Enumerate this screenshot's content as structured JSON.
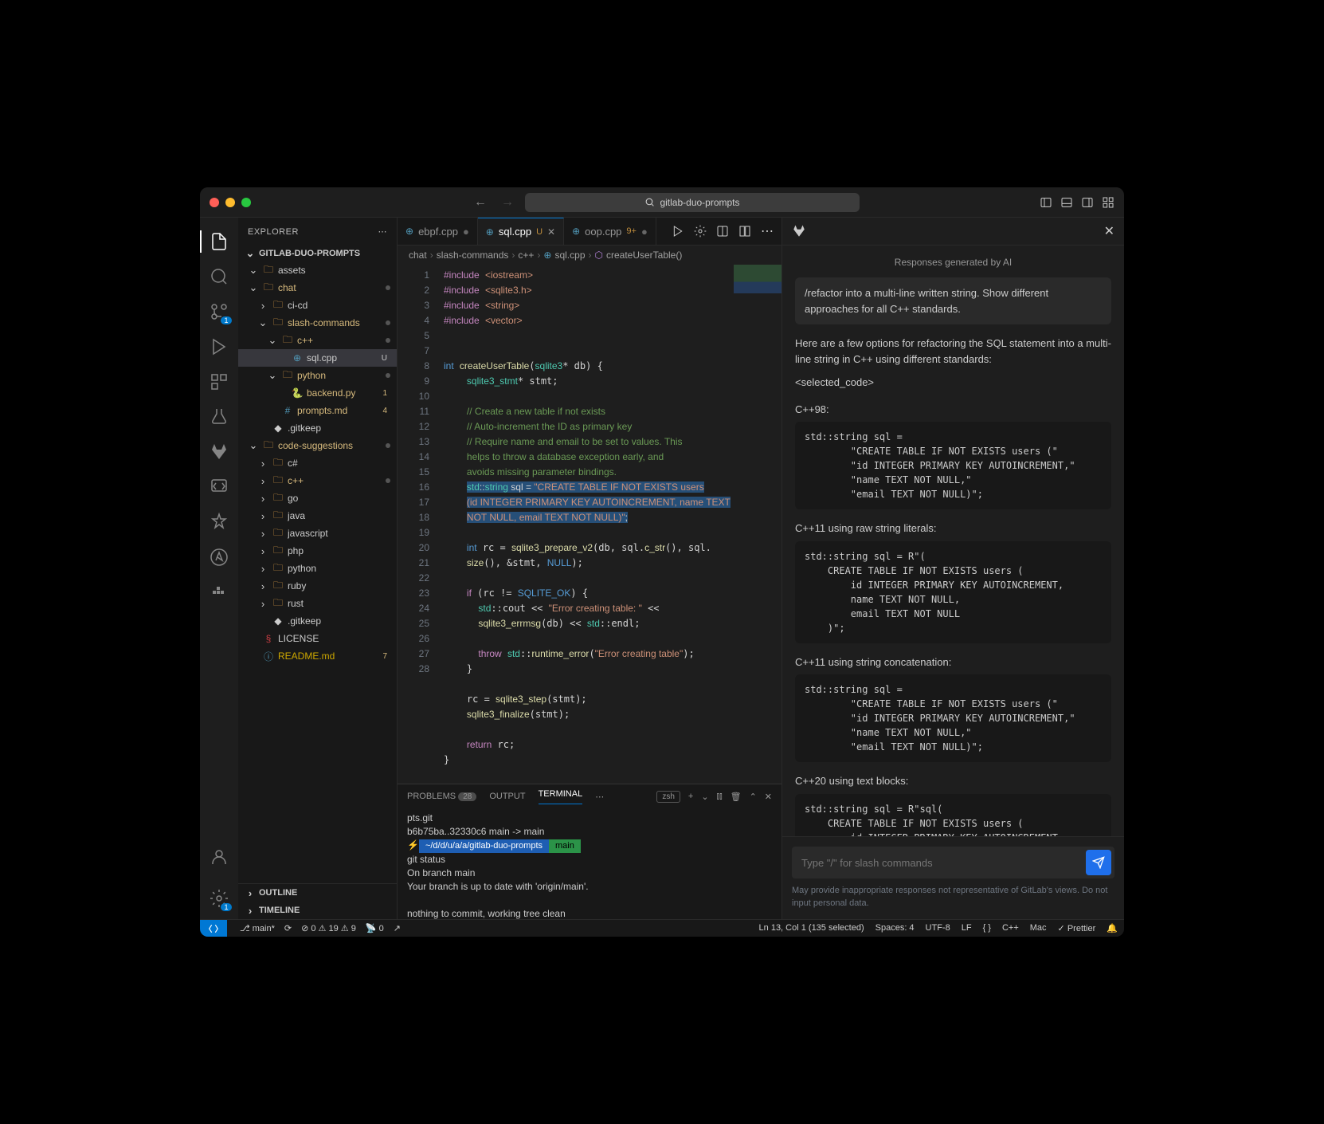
{
  "title": "gitlab-duo-prompts",
  "explorer": {
    "label": "EXPLORER",
    "project": "GITLAB-DUO-PROMPTS"
  },
  "tree": [
    {
      "d": 1,
      "t": "folder",
      "open": true,
      "name": "assets"
    },
    {
      "d": 1,
      "t": "folder",
      "open": true,
      "name": "chat",
      "mod": true
    },
    {
      "d": 2,
      "t": "folder",
      "open": false,
      "name": "ci-cd"
    },
    {
      "d": 2,
      "t": "folder",
      "open": true,
      "name": "slash-commands",
      "mod": true
    },
    {
      "d": 3,
      "t": "folder",
      "open": true,
      "name": "c++",
      "mod": true
    },
    {
      "d": 4,
      "t": "file",
      "ico": "cpp",
      "name": "sql.cpp",
      "sel": true,
      "badge": "U"
    },
    {
      "d": 3,
      "t": "folder",
      "open": true,
      "name": "python",
      "mod": true
    },
    {
      "d": 4,
      "t": "file",
      "ico": "py",
      "name": "backend.py",
      "badge": "1",
      "mod": true
    },
    {
      "d": 3,
      "t": "file",
      "ico": "md",
      "name": "prompts.md",
      "badge": "4",
      "mod": true
    },
    {
      "d": 2,
      "t": "file",
      "ico": "txt",
      "name": ".gitkeep"
    },
    {
      "d": 1,
      "t": "folder",
      "open": true,
      "name": "code-suggestions",
      "mod": true
    },
    {
      "d": 2,
      "t": "folder",
      "open": false,
      "name": "c#"
    },
    {
      "d": 2,
      "t": "folder",
      "open": false,
      "name": "c++",
      "mod": true
    },
    {
      "d": 2,
      "t": "folder",
      "open": false,
      "name": "go"
    },
    {
      "d": 2,
      "t": "folder",
      "open": false,
      "name": "java"
    },
    {
      "d": 2,
      "t": "folder",
      "open": false,
      "name": "javascript"
    },
    {
      "d": 2,
      "t": "folder",
      "open": false,
      "name": "php"
    },
    {
      "d": 2,
      "t": "folder",
      "open": false,
      "name": "python"
    },
    {
      "d": 2,
      "t": "folder",
      "open": false,
      "name": "ruby"
    },
    {
      "d": 2,
      "t": "folder",
      "open": false,
      "name": "rust"
    },
    {
      "d": 2,
      "t": "file",
      "ico": "txt",
      "name": ".gitkeep"
    },
    {
      "d": 1,
      "t": "file",
      "ico": "lic",
      "name": "LICENSE"
    },
    {
      "d": 1,
      "t": "file",
      "ico": "rm",
      "name": "README.md",
      "badge": "7",
      "mod": true,
      "warn": true
    }
  ],
  "outline": "OUTLINE",
  "timeline": "TIMELINE",
  "tabs": [
    {
      "name": "ebpf.cpp",
      "ico": "cpp",
      "dot": true
    },
    {
      "name": "sql.cpp",
      "ico": "cpp",
      "active": true,
      "mod": "U",
      "close": true
    },
    {
      "name": "oop.cpp",
      "ico": "cpp",
      "num": "9+",
      "dot": true
    }
  ],
  "crumbs": [
    "chat",
    "slash-commands",
    "c++",
    "sql.cpp",
    "createUserTable()"
  ],
  "lines": [
    "1",
    "2",
    "3",
    "4",
    "5",
    "",
    "7",
    "8",
    "9",
    "10",
    "11",
    "12",
    "",
    "13",
    "",
    "",
    "14",
    "15",
    "",
    "16",
    "17",
    "18",
    "",
    "19",
    "20",
    "21",
    "22",
    "23",
    "24",
    "25",
    "26",
    "27",
    "28"
  ],
  "panel": {
    "problems": "PROBLEMS",
    "problems_count": "28",
    "output": "OUTPUT",
    "terminal": "TERMINAL",
    "shell": "zsh"
  },
  "term": {
    "l1": "pts.git",
    "l2": "   b6b75ba..32330c6  main -> main",
    "prompt": "~/d/d/u/a/a/gitlab-duo-prompts",
    "branch": " main",
    "l3": "    git status",
    "l4": "On branch main",
    "l5": "Your branch is up to date with 'origin/main'.",
    "l6": "nothing to commit, working tree clean"
  },
  "ai": {
    "title": "Responses generated by AI",
    "prompt": "/refactor into a multi-line written string. Show different approaches for all C++ standards.",
    "intro": "Here are a few options for refactoring the SQL statement into a multi-line string in C++ using different standards:",
    "sel": "<selected_code>",
    "s1": "C++98:",
    "c1": "std::string sql =\n        \"CREATE TABLE IF NOT EXISTS users (\"\n        \"id INTEGER PRIMARY KEY AUTOINCREMENT,\"\n        \"name TEXT NOT NULL,\"\n        \"email TEXT NOT NULL)\";",
    "s2": "C++11 using raw string literals:",
    "c2": "std::string sql = R\"(\n    CREATE TABLE IF NOT EXISTS users (\n        id INTEGER PRIMARY KEY AUTOINCREMENT,\n        name TEXT NOT NULL,\n        email TEXT NOT NULL\n    )\";",
    "s3": "C++11 using string concatenation:",
    "c3": "std::string sql =\n        \"CREATE TABLE IF NOT EXISTS users (\"\n        \"id INTEGER PRIMARY KEY AUTOINCREMENT,\"\n        \"name TEXT NOT NULL,\"\n        \"email TEXT NOT NULL)\";",
    "s4": "C++20 using text blocks:",
    "c4": "std::string sql = R\"sql(\n    CREATE TABLE IF NOT EXISTS users (\n        id INTEGER PRIMARY KEY AUTOINCREMENT,\n        name TEXT NOT NULL,\n        email TEXT NOT NULL",
    "placeholder": "Type \"/\" for slash commands",
    "disclaimer": "May provide inappropriate responses not representative of GitLab's views. Do not input personal data."
  },
  "status": {
    "branch": "main*",
    "sync": "",
    "err": "0",
    "warn": "19",
    "info": "9",
    "ports": "0",
    "pos": "Ln 13, Col 1 (135 selected)",
    "spaces": "Spaces: 4",
    "enc": "UTF-8",
    "eol": "LF",
    "brk": "{ }",
    "lang": "C++",
    "os": "Mac",
    "prettier": "Prettier"
  }
}
